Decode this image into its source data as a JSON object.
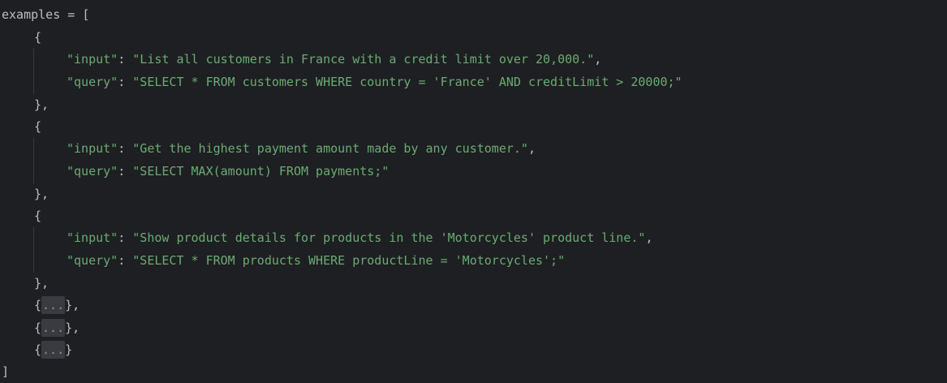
{
  "code": {
    "var_name": "examples",
    "assign": " = ",
    "open_bracket": "[",
    "close_bracket": "]",
    "open_brace": "{",
    "close_brace": "}",
    "close_brace_comma": "},",
    "colon": ": ",
    "comma": ",",
    "key_input": "\"input\"",
    "key_query": "\"query\"",
    "examples": [
      {
        "input": "\"List all customers in France with a credit limit over 20,000.\"",
        "query": "\"SELECT * FROM customers WHERE country = 'France' AND creditLimit > 20000;\""
      },
      {
        "input": "\"Get the highest payment amount made by any customer.\"",
        "query": "\"SELECT MAX(amount) FROM payments;\""
      },
      {
        "input": "\"Show product details for products in the 'Motorcycles' product line.\"",
        "query": "\"SELECT * FROM products WHERE productLine = 'Motorcycles';\""
      }
    ],
    "folded_placeholder": "...",
    "folded_items": [
      {
        "suffix": "},"
      },
      {
        "suffix": "},"
      },
      {
        "suffix": "}"
      }
    ]
  },
  "colors": {
    "background": "#1e1f22",
    "text": "#bcbec4",
    "string": "#6aab73",
    "fold_bg": "#393b40"
  }
}
